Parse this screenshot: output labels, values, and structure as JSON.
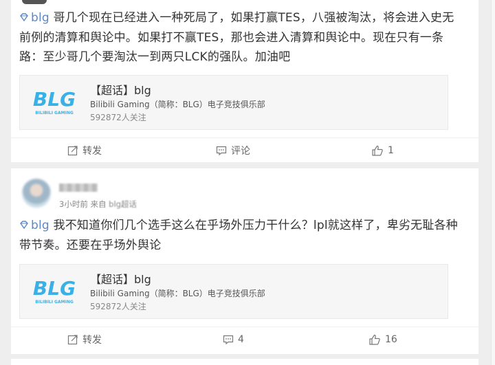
{
  "post1": {
    "tag": "blg",
    "text": "哥几个现在已经进入一种死局了，如果打赢TES，八强被淘汰，将会进入史无前例的清算和舆论中。如果打不赢TES，那也会进入清算和舆论中。现在只有一条路：至少哥几个要淘汰一到两只LCK的强队。加油吧",
    "topic": {
      "title": "【超话】blg",
      "subtitle": "Bilibili Gaming（简称：BLG）电子竞技俱乐部",
      "followers": "592872人关注",
      "logo_text": "BLG",
      "logo_small": "BILIBILI GAMING"
    },
    "actions": {
      "repost": "转发",
      "comment": "评论",
      "like": "1"
    }
  },
  "post2": {
    "time": "3小时前",
    "source_prefix": "来自",
    "source": "blg超话",
    "tag": "blg",
    "text": "我不知道你们几个选手这么在乎场外压力干什么？lpl就这样了，卑劣无耻各种带节奏。还要在乎场外舆论",
    "topic": {
      "title": "【超话】blg",
      "subtitle": "Bilibili Gaming（简称：BLG）电子竞技俱乐部",
      "followers": "592872人关注",
      "logo_text": "BLG",
      "logo_small": "BILIBILI GAMING"
    },
    "actions": {
      "repost": "转发",
      "comment": "4",
      "like": "16"
    }
  },
  "colors": {
    "tag": "#5d87c4",
    "logo": "#3ab1e6"
  }
}
